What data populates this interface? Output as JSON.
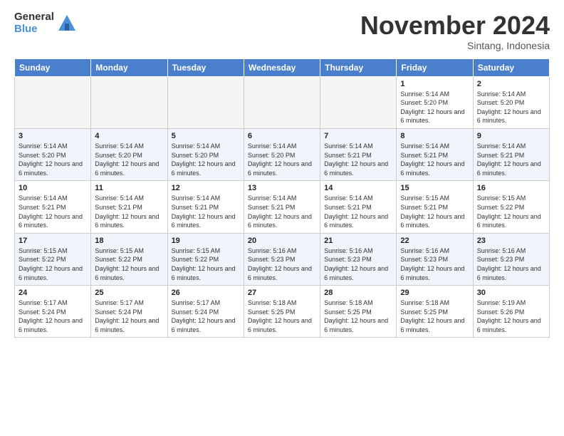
{
  "logo": {
    "general": "General",
    "blue": "Blue"
  },
  "header": {
    "month": "November 2024",
    "location": "Sintang, Indonesia"
  },
  "days_of_week": [
    "Sunday",
    "Monday",
    "Tuesday",
    "Wednesday",
    "Thursday",
    "Friday",
    "Saturday"
  ],
  "weeks": [
    [
      {
        "day": "",
        "empty": true
      },
      {
        "day": "",
        "empty": true
      },
      {
        "day": "",
        "empty": true
      },
      {
        "day": "",
        "empty": true
      },
      {
        "day": "",
        "empty": true
      },
      {
        "day": "1",
        "sunrise": "Sunrise: 5:14 AM",
        "sunset": "Sunset: 5:20 PM",
        "daylight": "Daylight: 12 hours and 6 minutes."
      },
      {
        "day": "2",
        "sunrise": "Sunrise: 5:14 AM",
        "sunset": "Sunset: 5:20 PM",
        "daylight": "Daylight: 12 hours and 6 minutes."
      }
    ],
    [
      {
        "day": "3",
        "sunrise": "Sunrise: 5:14 AM",
        "sunset": "Sunset: 5:20 PM",
        "daylight": "Daylight: 12 hours and 6 minutes."
      },
      {
        "day": "4",
        "sunrise": "Sunrise: 5:14 AM",
        "sunset": "Sunset: 5:20 PM",
        "daylight": "Daylight: 12 hours and 6 minutes."
      },
      {
        "day": "5",
        "sunrise": "Sunrise: 5:14 AM",
        "sunset": "Sunset: 5:20 PM",
        "daylight": "Daylight: 12 hours and 6 minutes."
      },
      {
        "day": "6",
        "sunrise": "Sunrise: 5:14 AM",
        "sunset": "Sunset: 5:20 PM",
        "daylight": "Daylight: 12 hours and 6 minutes."
      },
      {
        "day": "7",
        "sunrise": "Sunrise: 5:14 AM",
        "sunset": "Sunset: 5:21 PM",
        "daylight": "Daylight: 12 hours and 6 minutes."
      },
      {
        "day": "8",
        "sunrise": "Sunrise: 5:14 AM",
        "sunset": "Sunset: 5:21 PM",
        "daylight": "Daylight: 12 hours and 6 minutes."
      },
      {
        "day": "9",
        "sunrise": "Sunrise: 5:14 AM",
        "sunset": "Sunset: 5:21 PM",
        "daylight": "Daylight: 12 hours and 6 minutes."
      }
    ],
    [
      {
        "day": "10",
        "sunrise": "Sunrise: 5:14 AM",
        "sunset": "Sunset: 5:21 PM",
        "daylight": "Daylight: 12 hours and 6 minutes."
      },
      {
        "day": "11",
        "sunrise": "Sunrise: 5:14 AM",
        "sunset": "Sunset: 5:21 PM",
        "daylight": "Daylight: 12 hours and 6 minutes."
      },
      {
        "day": "12",
        "sunrise": "Sunrise: 5:14 AM",
        "sunset": "Sunset: 5:21 PM",
        "daylight": "Daylight: 12 hours and 6 minutes."
      },
      {
        "day": "13",
        "sunrise": "Sunrise: 5:14 AM",
        "sunset": "Sunset: 5:21 PM",
        "daylight": "Daylight: 12 hours and 6 minutes."
      },
      {
        "day": "14",
        "sunrise": "Sunrise: 5:14 AM",
        "sunset": "Sunset: 5:21 PM",
        "daylight": "Daylight: 12 hours and 6 minutes."
      },
      {
        "day": "15",
        "sunrise": "Sunrise: 5:15 AM",
        "sunset": "Sunset: 5:21 PM",
        "daylight": "Daylight: 12 hours and 6 minutes."
      },
      {
        "day": "16",
        "sunrise": "Sunrise: 5:15 AM",
        "sunset": "Sunset: 5:22 PM",
        "daylight": "Daylight: 12 hours and 6 minutes."
      }
    ],
    [
      {
        "day": "17",
        "sunrise": "Sunrise: 5:15 AM",
        "sunset": "Sunset: 5:22 PM",
        "daylight": "Daylight: 12 hours and 6 minutes."
      },
      {
        "day": "18",
        "sunrise": "Sunrise: 5:15 AM",
        "sunset": "Sunset: 5:22 PM",
        "daylight": "Daylight: 12 hours and 6 minutes."
      },
      {
        "day": "19",
        "sunrise": "Sunrise: 5:15 AM",
        "sunset": "Sunset: 5:22 PM",
        "daylight": "Daylight: 12 hours and 6 minutes."
      },
      {
        "day": "20",
        "sunrise": "Sunrise: 5:16 AM",
        "sunset": "Sunset: 5:23 PM",
        "daylight": "Daylight: 12 hours and 6 minutes."
      },
      {
        "day": "21",
        "sunrise": "Sunrise: 5:16 AM",
        "sunset": "Sunset: 5:23 PM",
        "daylight": "Daylight: 12 hours and 6 minutes."
      },
      {
        "day": "22",
        "sunrise": "Sunrise: 5:16 AM",
        "sunset": "Sunset: 5:23 PM",
        "daylight": "Daylight: 12 hours and 6 minutes."
      },
      {
        "day": "23",
        "sunrise": "Sunrise: 5:16 AM",
        "sunset": "Sunset: 5:23 PM",
        "daylight": "Daylight: 12 hours and 6 minutes."
      }
    ],
    [
      {
        "day": "24",
        "sunrise": "Sunrise: 5:17 AM",
        "sunset": "Sunset: 5:24 PM",
        "daylight": "Daylight: 12 hours and 6 minutes."
      },
      {
        "day": "25",
        "sunrise": "Sunrise: 5:17 AM",
        "sunset": "Sunset: 5:24 PM",
        "daylight": "Daylight: 12 hours and 6 minutes."
      },
      {
        "day": "26",
        "sunrise": "Sunrise: 5:17 AM",
        "sunset": "Sunset: 5:24 PM",
        "daylight": "Daylight: 12 hours and 6 minutes."
      },
      {
        "day": "27",
        "sunrise": "Sunrise: 5:18 AM",
        "sunset": "Sunset: 5:25 PM",
        "daylight": "Daylight: 12 hours and 6 minutes."
      },
      {
        "day": "28",
        "sunrise": "Sunrise: 5:18 AM",
        "sunset": "Sunset: 5:25 PM",
        "daylight": "Daylight: 12 hours and 6 minutes."
      },
      {
        "day": "29",
        "sunrise": "Sunrise: 5:18 AM",
        "sunset": "Sunset: 5:25 PM",
        "daylight": "Daylight: 12 hours and 6 minutes."
      },
      {
        "day": "30",
        "sunrise": "Sunrise: 5:19 AM",
        "sunset": "Sunset: 5:26 PM",
        "daylight": "Daylight: 12 hours and 6 minutes."
      }
    ]
  ]
}
